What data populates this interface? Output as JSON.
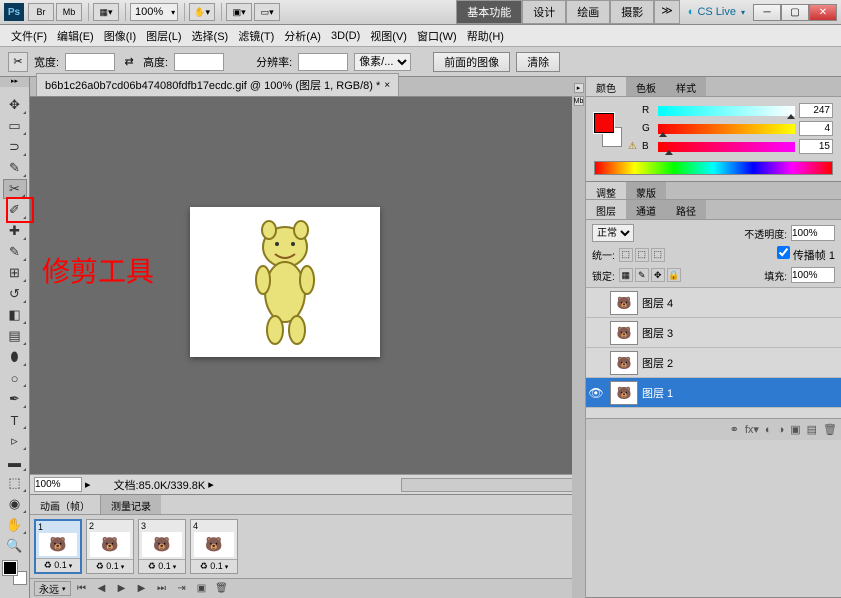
{
  "topbar": {
    "zoom": "100%",
    "workspaces": [
      "基本功能",
      "设计",
      "绘画",
      "摄影"
    ],
    "active_workspace": 0,
    "cslive": "CS Live"
  },
  "menu": [
    "文件(F)",
    "编辑(E)",
    "图像(I)",
    "图层(L)",
    "选择(S)",
    "滤镜(T)",
    "分析(A)",
    "3D(D)",
    "视图(V)",
    "窗口(W)",
    "帮助(H)"
  ],
  "optbar": {
    "width_label": "宽度:",
    "height_label": "高度:",
    "res_label": "分辨率:",
    "unit": "像素/...",
    "front_image": "前面的图像",
    "clear": "清除"
  },
  "doc": {
    "tab_title": "b6b1c26a0b7cd06b474080fdfb17ecdc.gif @ 100% (图层 1, RGB/8) *"
  },
  "status": {
    "zoom": "100%",
    "docinfo": "文档:85.0K/339.8K"
  },
  "animation": {
    "tabs": [
      "动画（帧）",
      "测量记录"
    ],
    "frames": [
      {
        "num": "1",
        "timing": "0.1",
        "sel": true
      },
      {
        "num": "2",
        "timing": "0.1",
        "sel": false
      },
      {
        "num": "3",
        "timing": "0.1",
        "sel": false
      },
      {
        "num": "4",
        "timing": "0.1",
        "sel": false
      }
    ],
    "loop": "永远"
  },
  "color_panel": {
    "tabs": [
      "颜色",
      "色板",
      "样式"
    ],
    "r": "247",
    "g": "4",
    "b": "15"
  },
  "adjust_tabs": [
    "调整",
    "蒙版"
  ],
  "layers_panel": {
    "tabs": [
      "图层",
      "通道",
      "路径"
    ],
    "blend": "正常",
    "opacity_label": "不透明度:",
    "opacity": "100%",
    "unify": "统一:",
    "propagate": "传播帧 1",
    "lock_label": "锁定:",
    "fill_label": "填充:",
    "fill": "100%",
    "layers": [
      {
        "name": "图层 4",
        "visible": false,
        "sel": false
      },
      {
        "name": "图层 3",
        "visible": false,
        "sel": false
      },
      {
        "name": "图层 2",
        "visible": false,
        "sel": false
      },
      {
        "name": "图层 1",
        "visible": true,
        "sel": true
      }
    ]
  },
  "annotation": "修剪工具"
}
